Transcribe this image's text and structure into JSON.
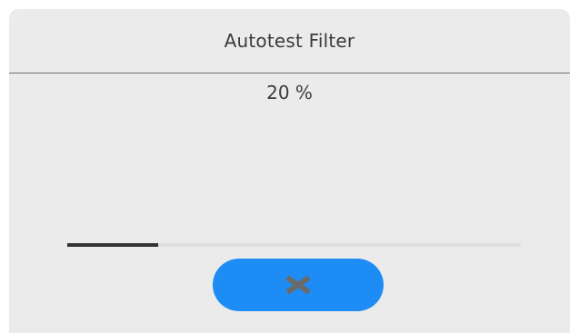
{
  "dialog": {
    "title": "Autotest Filter",
    "progress_text": "20 %",
    "progress_value": 0.2,
    "cancel_icon": "close-icon"
  },
  "colors": {
    "dialog_background": "#ebebeb",
    "button_background": "#1e8cf5",
    "progress_fill": "#333333",
    "progress_track": "#dedede",
    "close_icon": "#6a6a6a",
    "divider": "#6e6e6e"
  }
}
